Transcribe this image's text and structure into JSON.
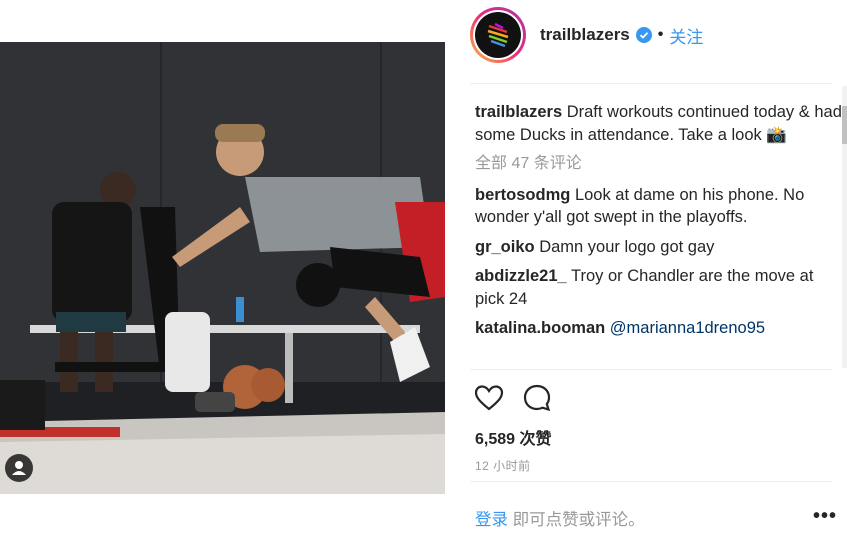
{
  "post": {
    "username": "trailblazers",
    "separator": "•",
    "follow_label": "关注",
    "caption": "Draft workouts continued today & had some Ducks in attendance. Take a look 📸",
    "view_all_comments": "全部 47 条评论",
    "comments": [
      {
        "user": "bertosodmg",
        "text": "Look at dame on his phone. No wonder y'all got swept in the playoffs.",
        "mention": ""
      },
      {
        "user": "gr_oiko",
        "text": "Damn your logo got gay",
        "mention": ""
      },
      {
        "user": "abdizzle21_",
        "text": "Troy or Chandler are the move at pick 24",
        "mention": ""
      },
      {
        "user": "katalina.booman",
        "text": "",
        "mention": "@marianna1dreno95"
      }
    ],
    "likes": "6,589 次赞",
    "time": "12 小时前",
    "login_link": "登录",
    "login_text": " 即可点赞或评论。",
    "more_label": "•••"
  },
  "icons": {
    "like": "heart-icon",
    "comment": "comment-icon",
    "verified": "verified-badge-icon",
    "user_tag": "user-tag-icon"
  },
  "carousel": {
    "count": 10,
    "active": 1
  },
  "colors": {
    "link_blue": "#3897f0",
    "verified_blue": "#3897f0",
    "muted": "#999999",
    "text": "#262626"
  }
}
